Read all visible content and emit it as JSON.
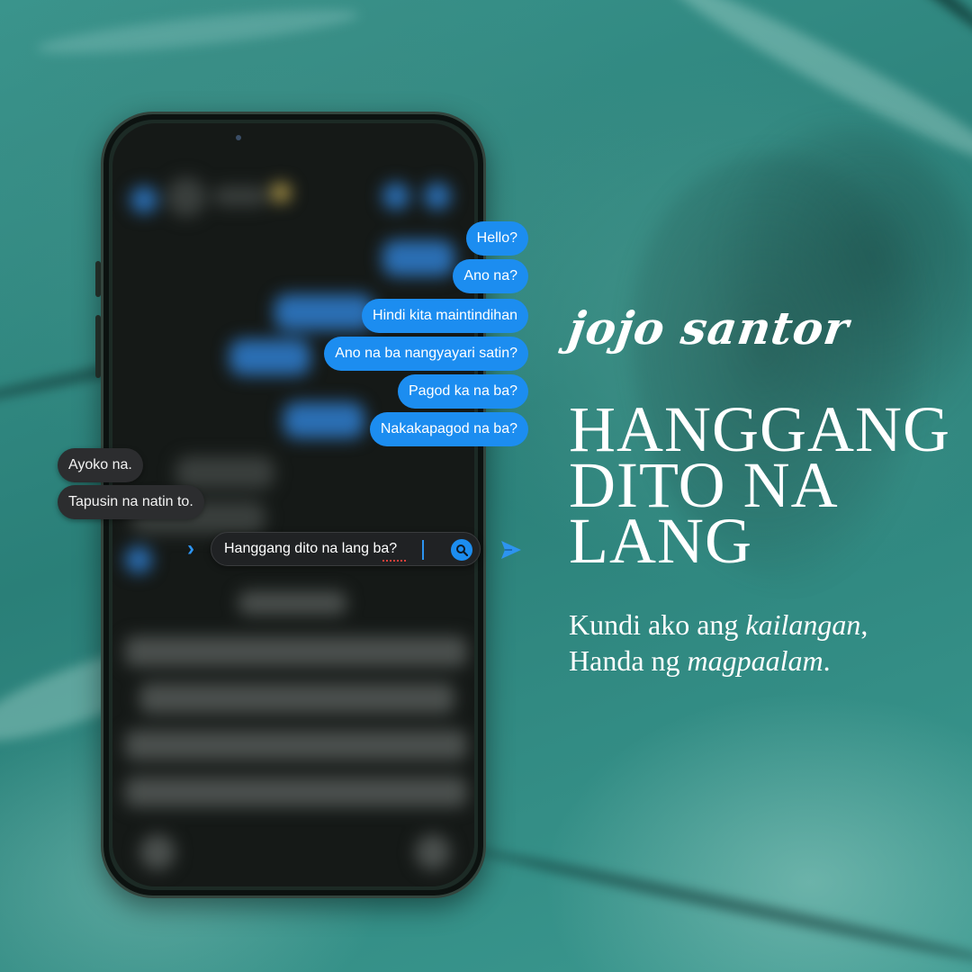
{
  "artist": "jojo santor",
  "title_lines": [
    "HANGGANG",
    "DITO NA",
    "LANG"
  ],
  "lyric": {
    "line1": {
      "text": "Kundi ako ang ",
      "emphasis": "kailangan",
      "tail": ","
    },
    "line2": {
      "text": "Handa ng ",
      "emphasis": "magpaalam",
      "tail": "."
    }
  },
  "chat": {
    "sent": [
      "Hello?",
      "Ano na?",
      "Hindi kita maintindihan",
      "Ano na ba nangyayari satin?",
      "Pagod ka na ba?",
      "Nakakapagod na ba?"
    ],
    "received": [
      "Ayoko na.",
      "Tapusin na natin to."
    ],
    "input_value": "Hanggang dito na lang ba?"
  },
  "colors": {
    "sent_bubble": "#1c8df0",
    "received_bubble": "#2c2d2f",
    "background": "#2f8a83",
    "text": "#ffffff"
  },
  "icons": {
    "expand": "chevron-right-icon",
    "search": "search-icon",
    "send": "send-arrow-icon"
  }
}
